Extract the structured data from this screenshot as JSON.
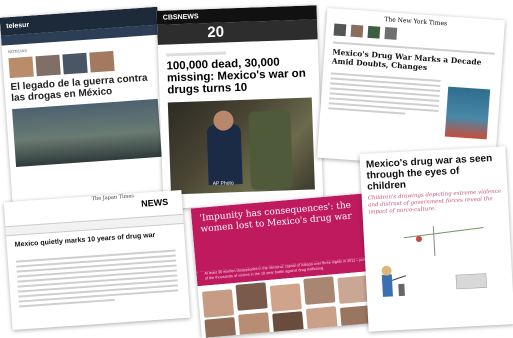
{
  "telesur": {
    "logo": "telesur",
    "section": "NOTICIAS",
    "headline": "El legado de la guerra contra las drogas en México"
  },
  "cbs": {
    "logo": "CBSNEWS",
    "banner": "20",
    "headline": "100,000 dead, 30,000 missing: Mexico's war on drugs turns 10",
    "photo_credit": "AP Photo"
  },
  "nyt": {
    "logo": "The New York Times",
    "headline": "Mexico's Drug War Marks a Decade Amid Doubts, Changes"
  },
  "japan_times": {
    "logo": "The Japan Times",
    "section": "NEWS",
    "headline": "Mexico quietly marks 10 years of drug war"
  },
  "impunity": {
    "headline": "'Impunity has consequences': the women lost to Mexico's drug war",
    "body": "At least 30 women disappeared in the Veracruz capital of Xalapa over three nights in 2011 – just some of the thousands of victims in the 10-year battle against drug trafficking."
  },
  "children": {
    "headline": "Mexico's drug war as seen through the eyes of children",
    "subhead": "Children's drawings depicting extreme violence and distrust of government forces reveal the impact of narco-culture."
  }
}
